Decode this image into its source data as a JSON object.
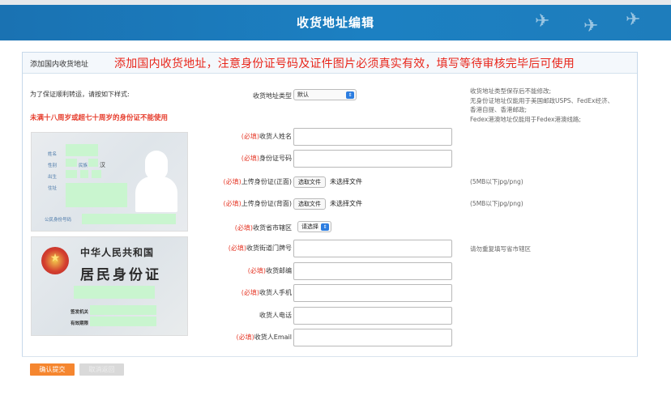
{
  "header": {
    "title": "收货地址编辑"
  },
  "panel": {
    "title": "添加国内收货地址"
  },
  "notice": "添加国内收货地址，注意身份证号码及证件图片必须真实有效，填写等待审核完毕后可使用",
  "hint": "为了保证顺利转运，请按如下样式:",
  "warning": "未满十八周岁或超七十周岁的身份证不能使用",
  "required_tag": "(必填)",
  "card_front": {
    "name_label": "姓名",
    "gender_label": "性别",
    "ethnicity_label": "民族",
    "ethnicity_value": "汉",
    "birth_label": "出生",
    "address_label": "住址",
    "id_label": "公民身份号码"
  },
  "card_back": {
    "title1": "中华人民共和国",
    "title2": "居民身份证",
    "issuer_label": "签发机关",
    "valid_label": "有效期限"
  },
  "form": {
    "address_type": {
      "label": "收货地址类型",
      "value": "默认"
    },
    "name": {
      "label": "收货人姓名"
    },
    "id_number": {
      "label": "身份证号码"
    },
    "id_front": {
      "label": "上传身份证(正面)",
      "button": "选取文件",
      "status": "未选择文件",
      "note": "(5MB以下jpg/png)"
    },
    "id_back": {
      "label": "上传身份证(背面)",
      "button": "选取文件",
      "status": "未选择文件",
      "note": "(5MB以下jpg/png)"
    },
    "region": {
      "label": "收货省市辖区",
      "value": "请选择"
    },
    "street": {
      "label": "收货街道门牌号",
      "note": "请勿重复填写省市辖区"
    },
    "zip": {
      "label": "收货邮编"
    },
    "mobile": {
      "label": "收货人手机"
    },
    "phone": {
      "label": "收货人电话"
    },
    "email": {
      "label": "收货人Email"
    }
  },
  "side_note": {
    "line1": "收货地址类型保存后不能修改;",
    "line2": "无身份证地址仅能用于美国邮政USPS、FedEx经济、",
    "line3": "香港自提、香港邮政;",
    "line4": "Fedex港澳地址仅能用于Fedex港澳线路;"
  },
  "buttons": {
    "confirm": "确认提交",
    "cancel": "取消返回"
  }
}
